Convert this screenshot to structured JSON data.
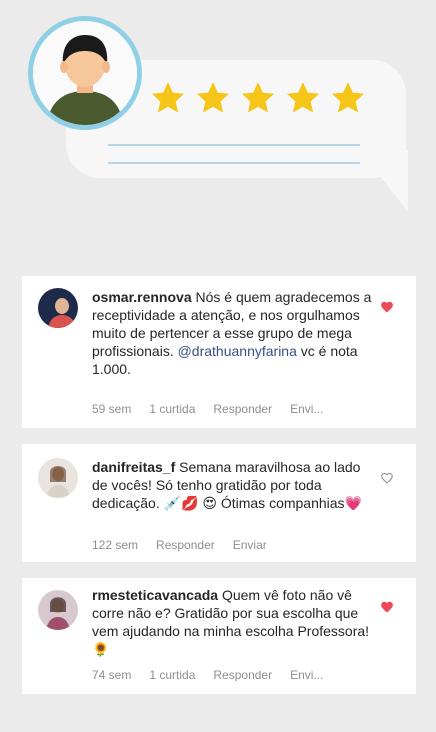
{
  "comments": [
    {
      "username": "osmar.rennova",
      "text_before": "Nós é quem agradecemos a receptividade a atenção, e nos orgulhamos muito de pertencer a esse grupo de mega profissionais. ",
      "mention": "@drathuannyfarina",
      "text_after": " vc é nota 1.000.",
      "time": "59 sem",
      "likes": "1 curtida",
      "reply": "Responder",
      "send": "Envi...",
      "liked": true
    },
    {
      "username": "danifreitas_f",
      "text_before": "Semana maravilhosa ao lado de vocês! Só tenho gratidão por toda dedicação. 💉💋 😍 Ótimas companhias💗",
      "mention": "",
      "text_after": "",
      "time": "122 sem",
      "reply": "Responder",
      "send": "Enviar",
      "liked": false
    },
    {
      "username": "rmesteticavancada",
      "text_before": "Quem vê foto não vê corre não e? Gratidão por sua escolha que vem ajudando na minha escolha Professora! 🌻",
      "mention": "",
      "text_after": "",
      "time": "74 sem",
      "likes": "1 curtida",
      "reply": "Responder",
      "send": "Envi...",
      "liked": true
    }
  ],
  "colors": {
    "heart_liked": "#ed4956",
    "star": "#f5c518",
    "mention": "#385185"
  }
}
